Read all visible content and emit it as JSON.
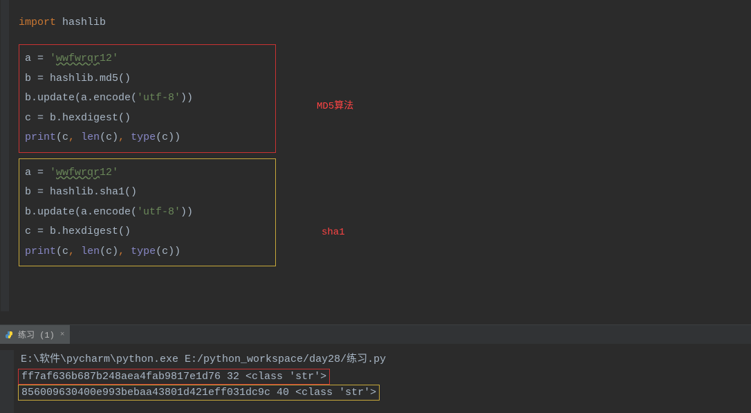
{
  "editor": {
    "import_kw": "import",
    "import_module": "hashlib",
    "box_md5": {
      "l1_a": "a = ",
      "l1_q1": "'",
      "l1_str": "wwfwrqr",
      "l1_tail": "12",
      "l1_q2": "'",
      "l2": "b = hashlib.md5()",
      "l3_pre": "b.update(a.encode(",
      "l3_str": "'utf-8'",
      "l3_post": "))",
      "l4": "c = b.hexdigest()",
      "l5_print": "print",
      "l5_open": "(c",
      "l5_c1": ",",
      "l5_sp1": " ",
      "l5_len": "len",
      "l5_lenarg": "(c)",
      "l5_c2": ",",
      "l5_sp2": " ",
      "l5_type": "type",
      "l5_typearg": "(c))"
    },
    "box_sha1": {
      "l1_a": "a = ",
      "l1_q1": "'",
      "l1_str": "wwfwrqr",
      "l1_tail": "12",
      "l1_q2": "'",
      "l2": "b = hashlib.sha1()",
      "l3_pre": "b.update(a.encode(",
      "l3_str": "'utf-8'",
      "l3_post": "))",
      "l4": "c = b.hexdigest()",
      "l5_print": "print",
      "l5_open": "(c",
      "l5_c1": ",",
      "l5_sp1": " ",
      "l5_len": "len",
      "l5_lenarg": "(c)",
      "l5_c2": ",",
      "l5_sp2": " ",
      "l5_type": "type",
      "l5_typearg": "(c))"
    },
    "annotation_md5": "MD5算法",
    "annotation_sha1": "sha1"
  },
  "console": {
    "tab_label": "练习 (1)",
    "cmd_line": "E:\\软件\\pycharm\\python.exe E:/python_workspace/day28/练习.py",
    "out_md5": "ff7af636b687b248aea4fab9817e1d76 32 <class 'str'>",
    "out_sha1": "856009630400e993bebaa43801d421eff031dc9c 40 <class 'str'>"
  }
}
